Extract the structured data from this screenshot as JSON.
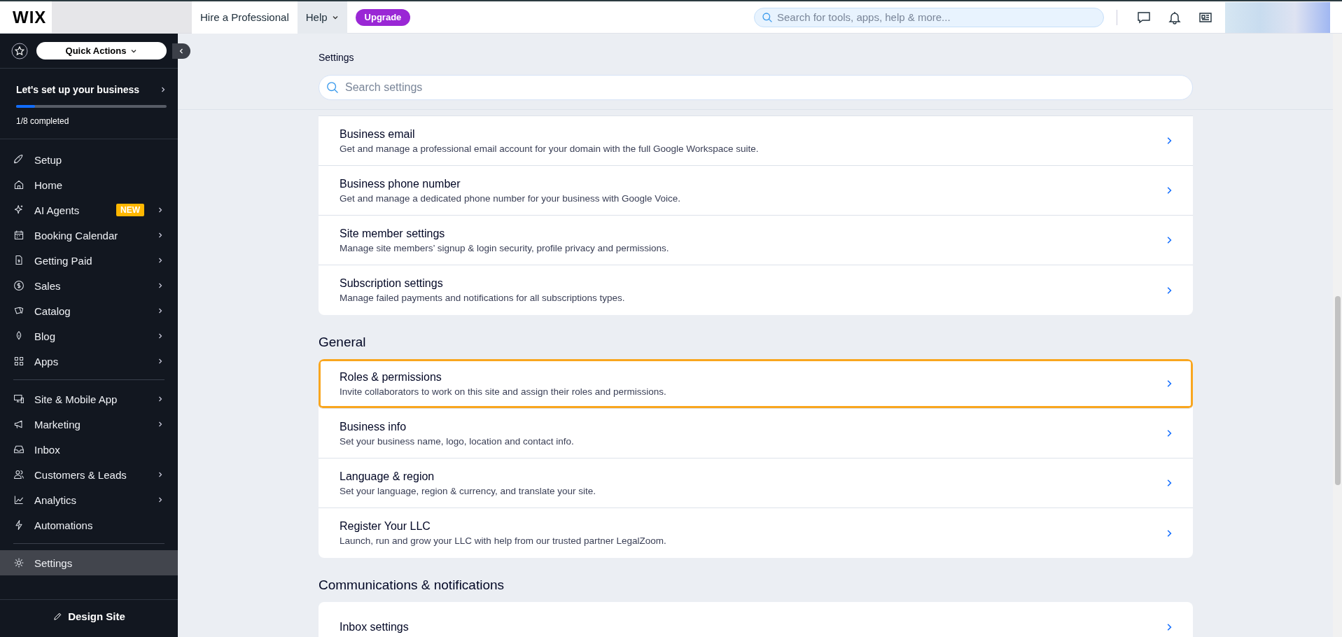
{
  "top_bar": {
    "logo": "WIX",
    "nav": [
      {
        "label": "Hire a Professional",
        "selected": false,
        "dropdown": false
      },
      {
        "label": "Help",
        "selected": true,
        "dropdown": true
      }
    ],
    "upgrade_button": "Upgrade",
    "search": {
      "placeholder": "Search for tools, apps, help & more..."
    }
  },
  "sidebar": {
    "quick_actions": "Quick Actions",
    "setup_card": {
      "title": "Let's set up your business",
      "level": 0.125,
      "progress_text": "1/8 completed"
    },
    "groups": [
      [
        {
          "label": "Setup",
          "arrow": false,
          "selected": false
        },
        {
          "label": "Home",
          "arrow": false,
          "selected": false
        },
        {
          "label": "AI Agents",
          "arrow": true,
          "badge": "NEW",
          "selected": false
        },
        {
          "label": "Booking Calendar",
          "arrow": true,
          "selected": false
        },
        {
          "label": "Getting Paid",
          "arrow": true,
          "selected": false
        },
        {
          "label": "Sales",
          "arrow": true,
          "selected": false
        },
        {
          "label": "Catalog",
          "arrow": true,
          "selected": false
        },
        {
          "label": "Blog",
          "arrow": true,
          "selected": false
        },
        {
          "label": "Apps",
          "arrow": true,
          "selected": false
        }
      ],
      [
        {
          "label": "Site & Mobile App",
          "arrow": true,
          "selected": false
        },
        {
          "label": "Marketing",
          "arrow": true,
          "selected": false
        },
        {
          "label": "Inbox",
          "arrow": false,
          "selected": false
        },
        {
          "label": "Customers & Leads",
          "arrow": true,
          "selected": false
        },
        {
          "label": "Analytics",
          "arrow": true,
          "selected": false
        },
        {
          "label": "Automations",
          "arrow": false,
          "selected": false
        }
      ],
      [
        {
          "label": "Settings",
          "arrow": false,
          "selected": true
        }
      ]
    ],
    "design_site": "Design Site"
  },
  "page": {
    "title": "Settings",
    "search": {
      "placeholder": "Search settings"
    },
    "sections": [
      {
        "rows": [
          {
            "title": "Business email",
            "description": "Get and manage a professional email account for your domain with the full Google Workspace suite.",
            "highlighted": false
          },
          {
            "title": "Business phone number",
            "description": "Get and manage a dedicated phone number for your business with Google Voice.",
            "highlighted": false
          },
          {
            "title": "Site member settings",
            "description": "Manage site members’ signup & login security, profile privacy and permissions.",
            "highlighted": false
          },
          {
            "title": "Subscription settings",
            "description": "Manage failed payments and notifications for all subscriptions types.",
            "highlighted": false
          }
        ]
      },
      {
        "heading": "General",
        "rows": [
          {
            "title": "Roles & permissions",
            "description": "Invite collaborators to work on this site and assign their roles and permissions.",
            "highlighted": true
          },
          {
            "title": "Business info",
            "description": "Set your business name, logo, location and contact info.",
            "highlighted": false
          },
          {
            "title": "Language & region",
            "description": "Set your language, region & currency, and translate your site.",
            "highlighted": false
          },
          {
            "title": "Register Your LLC",
            "description": "Launch, run and grow your LLC with help from our trusted partner LegalZoom.",
            "highlighted": false
          }
        ]
      },
      {
        "heading": "Communications & notifications",
        "rows": [
          {
            "title": "Inbox settings",
            "highlighted": false
          }
        ]
      }
    ]
  }
}
